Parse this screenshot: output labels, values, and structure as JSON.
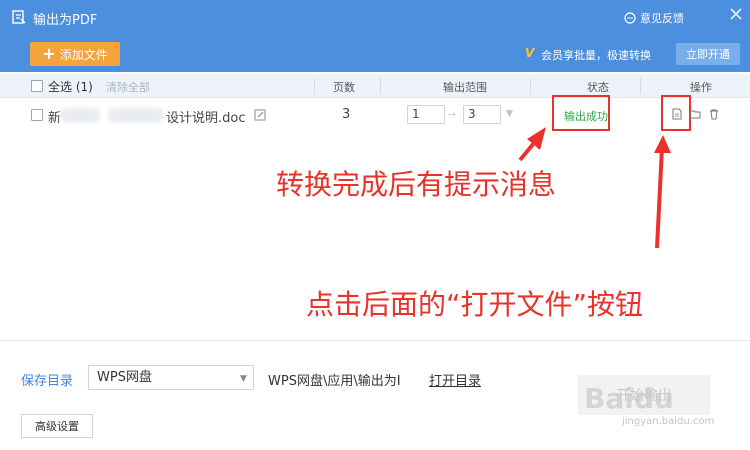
{
  "window": {
    "title": "输出为PDF",
    "feedback_label": "意见反馈"
  },
  "toolbar": {
    "add_file_label": "添加文件",
    "vip_text": "会员享批量，极速转换",
    "open_vip_label": "立即开通"
  },
  "table": {
    "select_all_label": "全选 (1)",
    "clear_all_label": "清除全部",
    "headers": {
      "pages": "页数",
      "range": "输出范围",
      "status": "状态",
      "ops": "操作"
    },
    "rows": [
      {
        "name_start": "新",
        "name_end": "设计说明.doc",
        "pages": "3",
        "range_from": "1",
        "range_to": "3",
        "status": "输出成功"
      }
    ]
  },
  "annotations": {
    "status_hint": "转换完成后有提示消息",
    "open_file_hint": "点击后面的“打开文件”按钮",
    "color": "#e8322b"
  },
  "footer": {
    "save_dir_label": "保存目录",
    "dir_select_value": "WPS网盘",
    "path_text": "WPS网盘\\应用\\输出为I",
    "open_dir_label": "打开目录",
    "start_label": "开始输出",
    "advanced_label": "高级设置"
  },
  "watermark": {
    "logo": "Baidu",
    "url": "jingyan.baidu.com"
  },
  "colors": {
    "titlebar": "#4b8fde",
    "add_button": "#f4a43a",
    "success": "#2aa847",
    "link": "#3f86d8"
  }
}
